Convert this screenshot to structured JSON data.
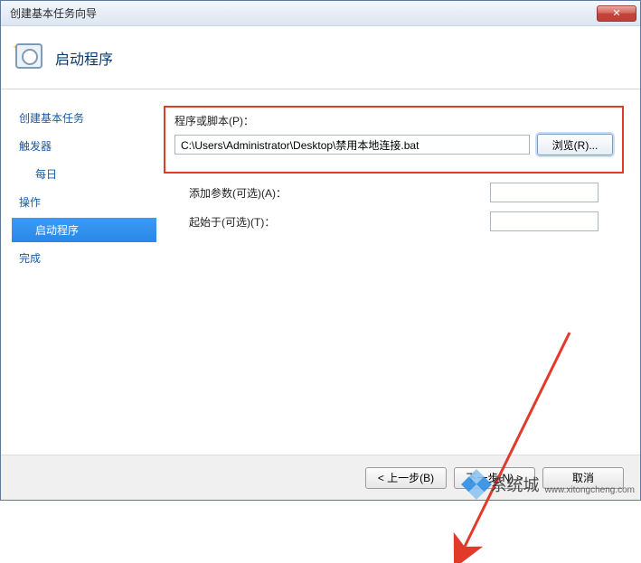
{
  "titlebar": {
    "title": "创建基本任务向导",
    "close_glyph": "✕"
  },
  "header": {
    "title": "启动程序"
  },
  "sidebar": {
    "items": [
      {
        "label": "创建基本任务",
        "sub": false,
        "selected": false
      },
      {
        "label": "触发器",
        "sub": false,
        "selected": false
      },
      {
        "label": "每日",
        "sub": true,
        "selected": false
      },
      {
        "label": "操作",
        "sub": false,
        "selected": false
      },
      {
        "label": "启动程序",
        "sub": true,
        "selected": true
      },
      {
        "label": "完成",
        "sub": false,
        "selected": false
      }
    ]
  },
  "main": {
    "script_label": "程序或脚本(P)：",
    "script_value": "C:\\Users\\Administrator\\Desktop\\禁用本地连接.bat",
    "browse_label": "浏览(R)...",
    "args_label": "添加参数(可选)(A)：",
    "args_value": "",
    "startin_label": "起始于(可选)(T)：",
    "startin_value": ""
  },
  "footer": {
    "back": "< 上一步(B)",
    "next": "下一步(N) >",
    "cancel": "取消"
  },
  "watermark": {
    "brand": "系统城",
    "url": "www.xitongcheng.com"
  }
}
